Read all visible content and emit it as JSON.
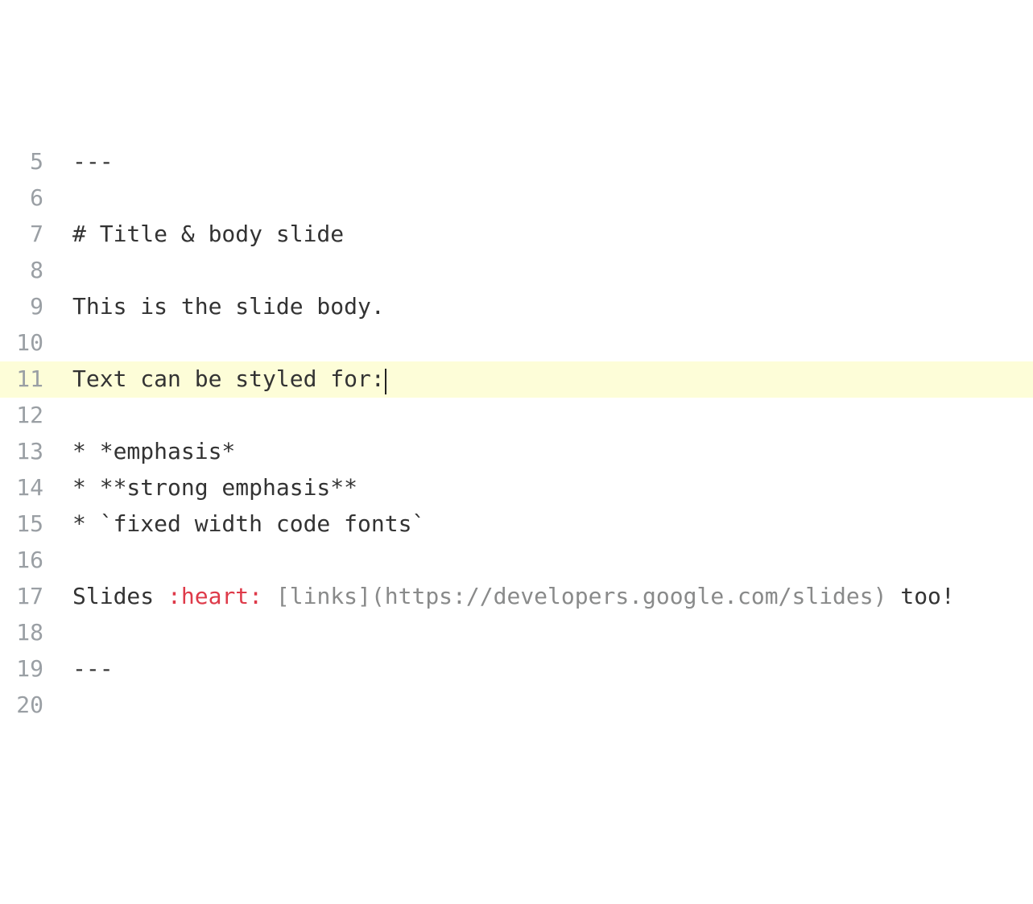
{
  "first_line_number": 5,
  "highlighted_line_index": 6,
  "cursor_line_index": 6,
  "lines": [
    [
      {
        "text": "---"
      }
    ],
    [],
    [
      {
        "text": "# Title & body slide"
      }
    ],
    [],
    [
      {
        "text": "This is the slide body."
      }
    ],
    [],
    [
      {
        "text": "Text can be styled for:"
      }
    ],
    [],
    [
      {
        "text": "* *emphasis*"
      }
    ],
    [
      {
        "text": "* **strong emphasis**"
      }
    ],
    [
      {
        "text": "* `fixed width code fonts`"
      }
    ],
    [],
    [
      {
        "text": "Slides "
      },
      {
        "text": ":heart:",
        "cls": "tok-red"
      },
      {
        "text": " "
      },
      {
        "text": "[links](https://developers.google.com/slides)",
        "cls": "tok-grey"
      },
      {
        "text": " too!"
      }
    ],
    [],
    [
      {
        "text": "---"
      }
    ],
    []
  ]
}
